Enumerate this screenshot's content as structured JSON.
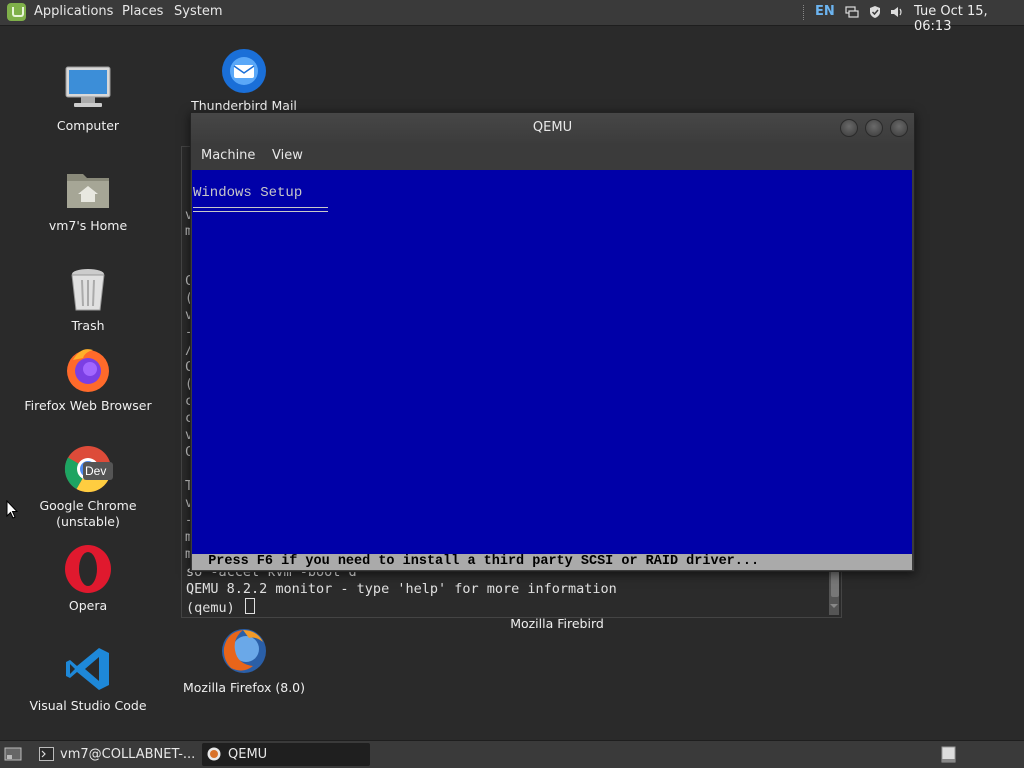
{
  "top_panel": {
    "menus": [
      "Applications",
      "Places",
      "System"
    ],
    "keyboard_layout": "EN",
    "clock": "Tue Oct 15, 06:13"
  },
  "desktop_icons": {
    "computer": "Computer",
    "home": "vm7's Home",
    "trash": "Trash",
    "firefox": "Firefox Web Browser",
    "chrome": [
      "Google Chrome",
      "(unstable)"
    ],
    "chrome_badge": "Dev",
    "opera": "Opera",
    "vscode": "Visual Studio Code",
    "thunderbird": "Thunderbird Mail",
    "firebird": "Mozilla Firebird",
    "firefox8": "Mozilla Firefox (8.0)"
  },
  "terminal": {
    "lines": [
      "so -accel kvm -boot d",
      "QEMU 8.2.2 monitor - type 'help' for more information",
      "(qemu) "
    ],
    "left_edge_chars": [
      "v",
      "m",
      "",
      "",
      "C",
      "(",
      "v",
      "-",
      "/",
      "C",
      "(",
      "c",
      "c",
      "v",
      "C",
      "",
      "T",
      "v",
      "-",
      "m",
      "m"
    ]
  },
  "qemu_window": {
    "title": "QEMU",
    "menu": [
      "Machine",
      "View"
    ],
    "screen_title": "Windows Setup",
    "status_text": "  Press F6 if you need to install a third party SCSI or RAID driver..."
  },
  "taskbar": {
    "tasks": [
      "vm7@COLLABNET-...",
      "QEMU"
    ]
  },
  "colors": {
    "vm_background": "#0000a8",
    "vm_status_bar": "#aaaaaa",
    "keyboard_layout": "#6cb4f0"
  }
}
